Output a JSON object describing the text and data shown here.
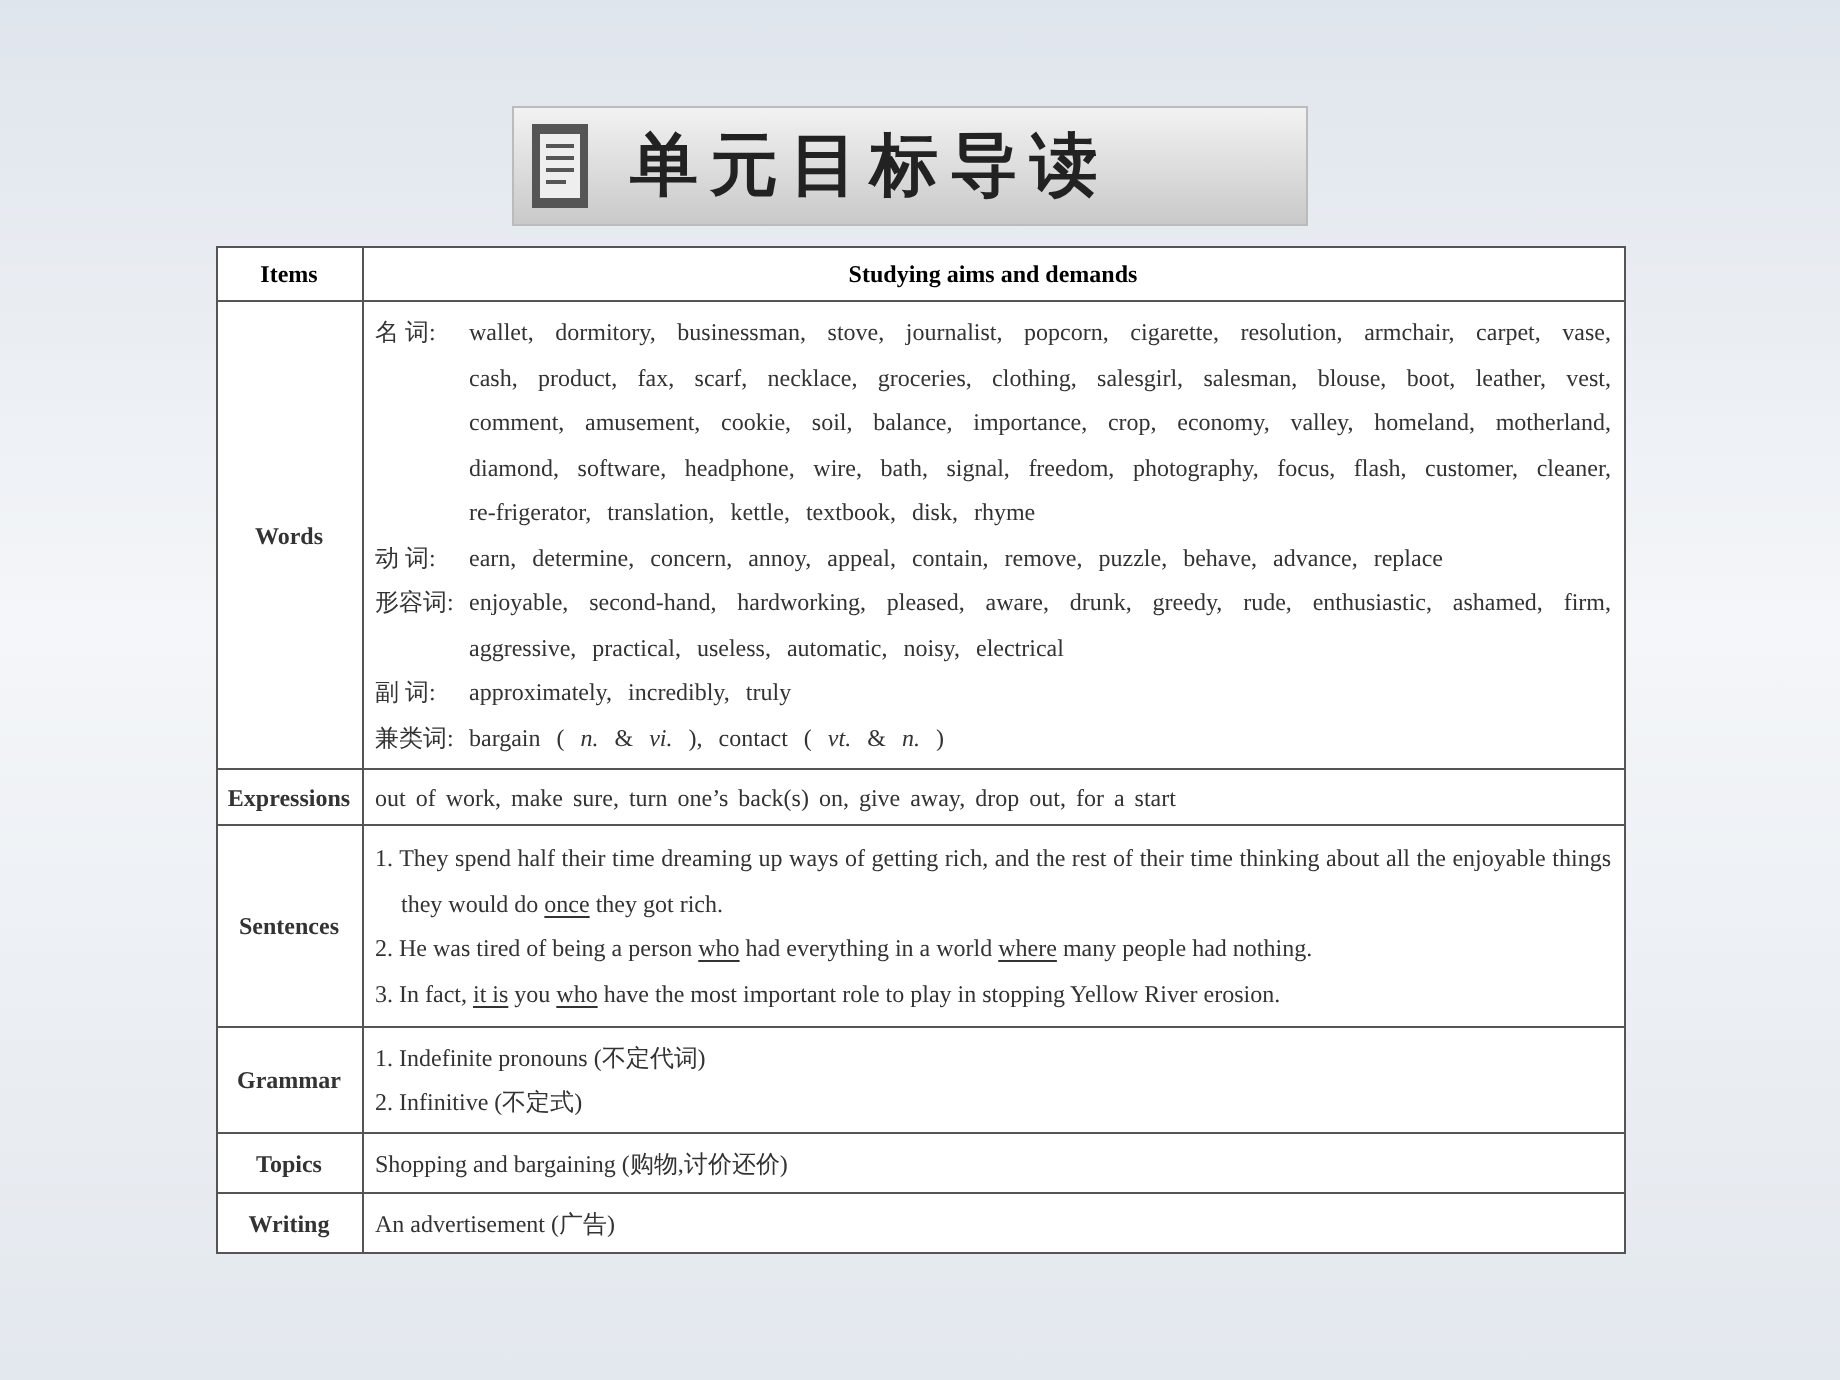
{
  "banner": {
    "title": "单元目标导读"
  },
  "table": {
    "columns": [
      "Items",
      "Studying aims and demands"
    ],
    "words": {
      "item": "Words",
      "entries": [
        {
          "label": "名 词:",
          "text": "wallet, dormitory, businessman, stove, journalist, popcorn, cigarette, resolution, armchair, carpet, vase, cash, product, fax, scarf, necklace, groceries, clothing, salesgirl, salesman, blouse, boot, leather, vest, comment, amusement, cookie, soil, balance, importance, crop, economy, valley, homeland, motherland, diamond, software, headphone, wire, bath, signal, freedom, photography, focus, flash, customer, cleaner, re-frigerator, translation, kettle, textbook, disk, rhyme"
        },
        {
          "label": "动 词:",
          "text": "earn, determine, concern, annoy, appeal, contain, remove, puzzle, behave, advance, replace"
        },
        {
          "label": "形容词:",
          "text": "enjoyable, second-hand, hardworking, pleased, aware, drunk, greedy, rude, enthusiastic, ashamed, firm, aggressive, practical, useless, automatic, noisy, electrical"
        },
        {
          "label": "副 词:",
          "text": "approximately, incredibly, truly"
        },
        {
          "label": "兼类词:",
          "text": "bargain ( *n.* & *vi.* ), contact ( *vt.* & *n.* )"
        }
      ]
    },
    "expressions": {
      "item": "Expressions",
      "text": "out of work, make sure, turn one’s back(s) on, give away, drop out, for a start"
    },
    "sentences": {
      "item": "Sentences",
      "lines": [
        [
          {
            "text": "1. They spend half their time dreaming up ways of getting rich, and the rest of their time thinking about all the enjoyable things they would do ",
            "underlined": false
          },
          {
            "text": "once",
            "underlined": true
          },
          {
            "text": " they got rich.",
            "underlined": false
          }
        ],
        [
          {
            "text": "2. He was tired of being a person ",
            "underlined": false
          },
          {
            "text": "who",
            "underlined": true
          },
          {
            "text": " had everything in a world ",
            "underlined": false
          },
          {
            "text": "where",
            "underlined": true
          },
          {
            "text": " many people had nothing.",
            "underlined": false
          }
        ],
        [
          {
            "text": "3. In fact, ",
            "underlined": false
          },
          {
            "text": "it is",
            "underlined": true
          },
          {
            "text": " you ",
            "underlined": false
          },
          {
            "text": "who",
            "underlined": true
          },
          {
            "text": " have the most important role to play in stopping Yellow River erosion.",
            "underlined": false
          }
        ]
      ]
    },
    "grammar": {
      "item": "Grammar",
      "lines": [
        "1. Indefinite pronouns (不定代词)",
        "2. Infinitive (不定式)"
      ]
    },
    "topics": {
      "item": "Topics",
      "text": "Shopping and bargaining (购物,讨价还价)"
    },
    "writing": {
      "item": "Writing",
      "text": "An advertisement (广告)"
    }
  }
}
